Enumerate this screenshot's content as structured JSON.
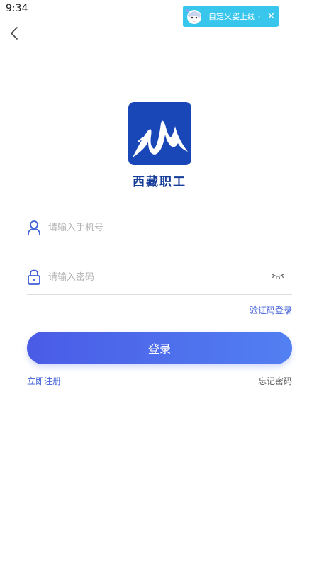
{
  "status_bar": {
    "time": "9:34"
  },
  "notification": {
    "text": "自定义姿上线",
    "arrow": "›",
    "close": "✕"
  },
  "brand": {
    "app_name": "西藏职工"
  },
  "form": {
    "phone_placeholder": "请输入手机号",
    "password_placeholder": "请输入密码",
    "sms_login_label": "验证码登录",
    "login_button_label": "登录",
    "register_label": "立即注册",
    "forgot_password_label": "忘记密码"
  },
  "colors": {
    "accent": "#3f5fd8",
    "logo_bg": "#1a47b8",
    "notif_bg": "#39c6ec"
  },
  "icons": {
    "back": "chevron-left-icon",
    "user": "user-icon",
    "lock": "lock-icon",
    "eye": "eye-closed-icon"
  }
}
